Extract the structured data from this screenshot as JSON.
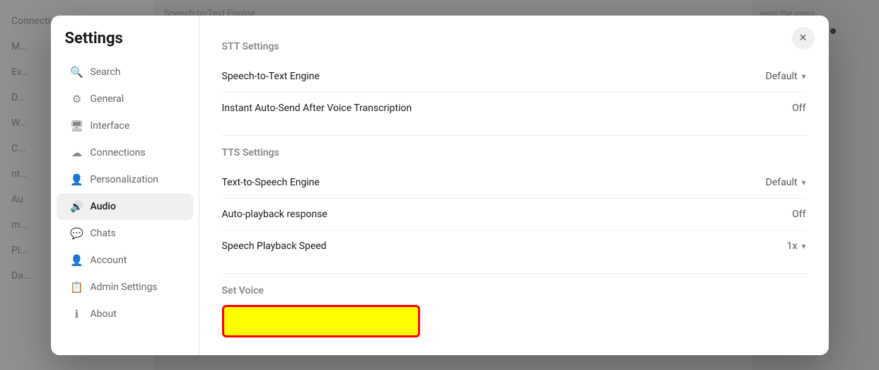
{
  "app": {
    "background_title": "Speech-to-Text Engine"
  },
  "modal": {
    "title": "Settings",
    "close_label": "×"
  },
  "sidebar": {
    "items": [
      {
        "id": "search",
        "label": "Search",
        "icon": "🔍",
        "active": false
      },
      {
        "id": "general",
        "label": "General",
        "icon": "⚙",
        "active": false
      },
      {
        "id": "interface",
        "label": "Interface",
        "icon": "🖥",
        "active": false
      },
      {
        "id": "connections",
        "label": "Connections",
        "icon": "☁",
        "active": false
      },
      {
        "id": "personalization",
        "label": "Personalization",
        "icon": "👤",
        "active": false
      },
      {
        "id": "audio",
        "label": "Audio",
        "icon": "🔊",
        "active": true
      },
      {
        "id": "chats",
        "label": "Chats",
        "icon": "💬",
        "active": false
      },
      {
        "id": "account",
        "label": "Account",
        "icon": "👤",
        "active": false
      },
      {
        "id": "admin-settings",
        "label": "Admin Settings",
        "icon": "📋",
        "active": false
      },
      {
        "id": "about",
        "label": "About",
        "icon": "ℹ",
        "active": false
      }
    ]
  },
  "content": {
    "stt_section_header": "STT Settings",
    "tts_section_header": "TTS Settings",
    "set_voice_header": "Set Voice",
    "settings": {
      "speech_to_text_engine": {
        "label": "Speech-to-Text Engine",
        "value": "Default"
      },
      "instant_auto_send": {
        "label": "Instant Auto-Send After Voice Transcription",
        "value": "Off"
      },
      "text_to_speech_engine": {
        "label": "Text-to-Speech Engine",
        "value": "Default"
      },
      "auto_playback": {
        "label": "Auto-playback response",
        "value": "Off"
      },
      "speech_playback_speed": {
        "label": "Speech Playback Speed",
        "value": "1x"
      }
    }
  }
}
